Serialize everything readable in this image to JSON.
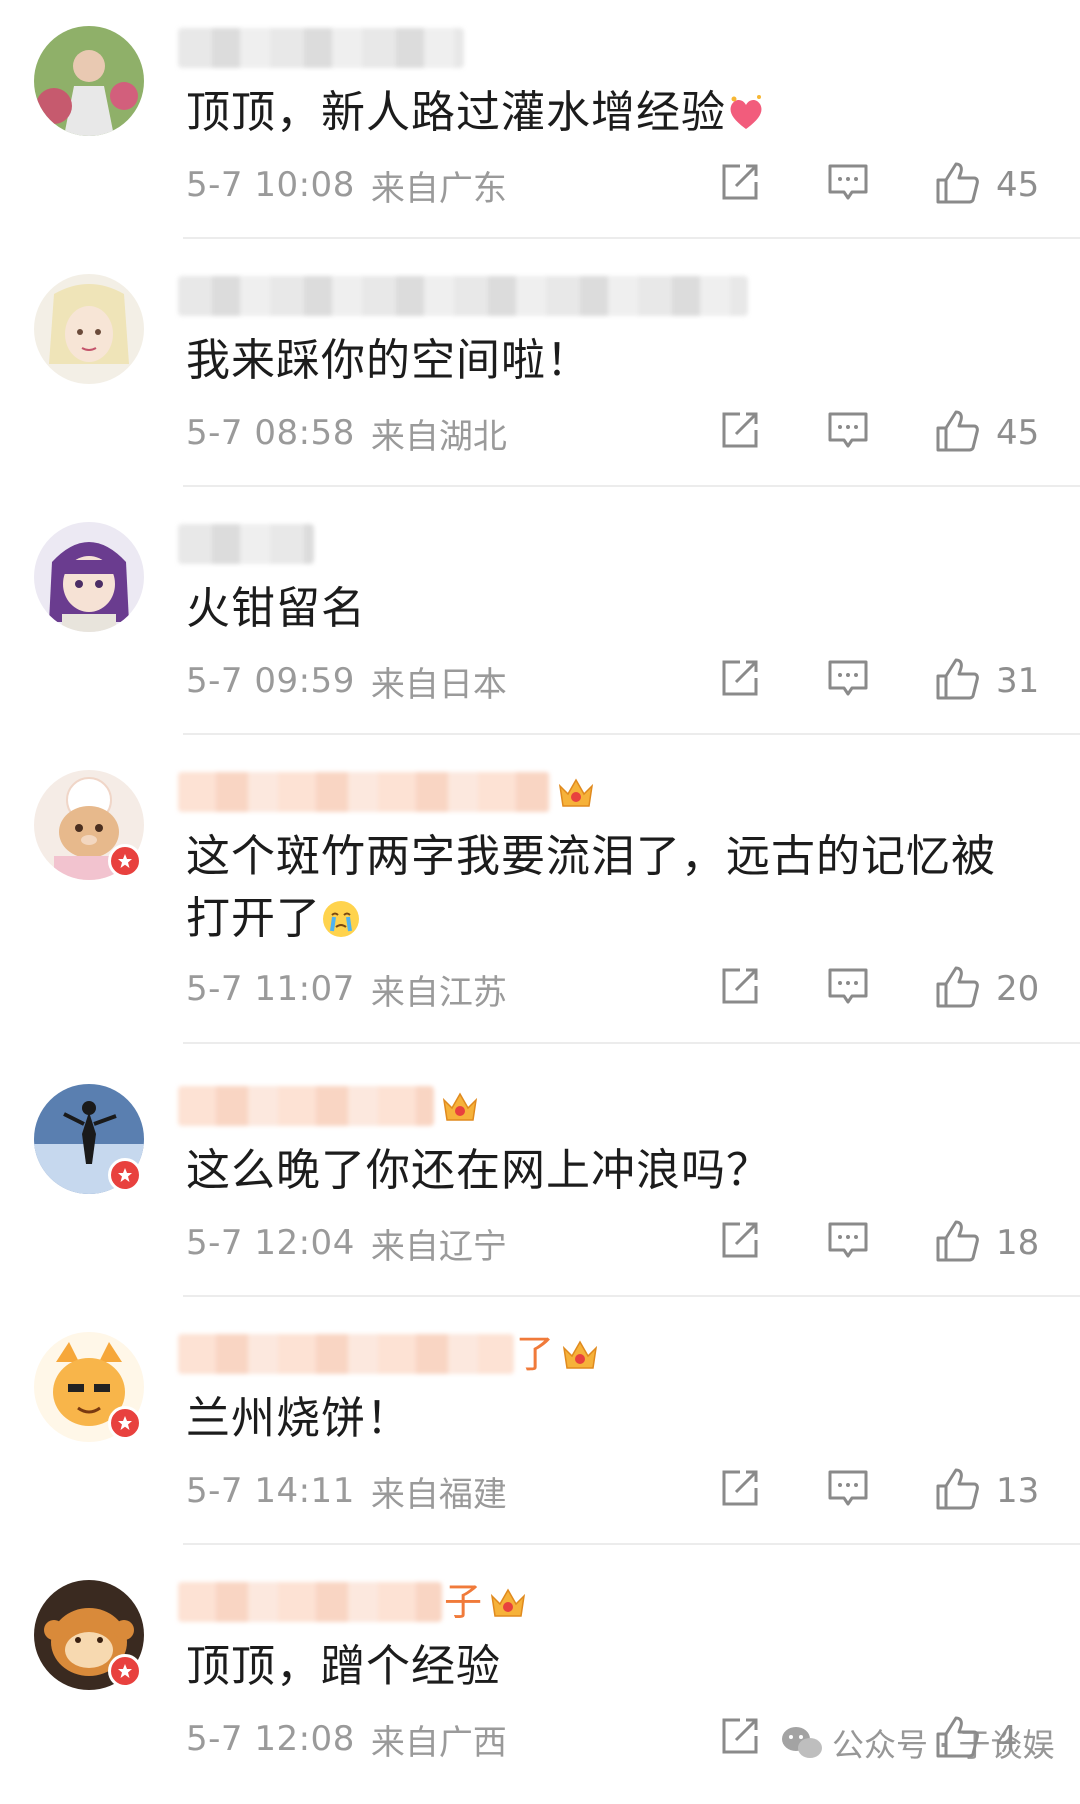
{
  "colors": {
    "badge": "#e8413e",
    "meta": "#9a9a9a",
    "vip_name": "#f07a3a"
  },
  "comments": [
    {
      "username_suffix": "",
      "has_crown": false,
      "crown_level": "",
      "verified": false,
      "text": "顶顶，新人路过灌水增经验",
      "emoji": "heart-sparkle-icon",
      "time": "5-7 10:08",
      "location": "来自广东",
      "likes": "45"
    },
    {
      "username_suffix": "",
      "has_crown": false,
      "crown_level": "",
      "verified": false,
      "text": "我来踩你的空间啦！",
      "emoji": "",
      "time": "5-7 08:58",
      "location": "来自湖北",
      "likes": "45"
    },
    {
      "username_suffix": "",
      "has_crown": false,
      "crown_level": "",
      "verified": false,
      "text": "火钳留名",
      "emoji": "",
      "time": "5-7 09:59",
      "location": "来自日本",
      "likes": "31"
    },
    {
      "username_suffix": "",
      "has_crown": true,
      "crown_level": "8",
      "verified": true,
      "text": "这个斑竹两字我要流泪了，远古的记忆被打开了",
      "emoji": "crying-face-icon",
      "time": "5-7 11:07",
      "location": "来自江苏",
      "likes": "20"
    },
    {
      "username_suffix": "",
      "has_crown": true,
      "crown_level": "",
      "verified": true,
      "text": "这么晚了你还在网上冲浪吗？",
      "emoji": "",
      "time": "5-7 12:04",
      "location": "来自辽宁",
      "likes": "18"
    },
    {
      "username_suffix": "了",
      "has_crown": true,
      "crown_level": "5",
      "verified": true,
      "text": "兰州烧饼！",
      "emoji": "",
      "time": "5-7 14:11",
      "location": "来自福建",
      "likes": "13"
    },
    {
      "username_suffix": "子",
      "has_crown": true,
      "crown_level": "6",
      "verified": true,
      "text": "顶顶，蹭个经验",
      "emoji": "",
      "time": "5-7 12:08",
      "location": "来自广西",
      "likes": "4"
    }
  ],
  "watermark": {
    "text": "公众号 · 于谈娱"
  }
}
